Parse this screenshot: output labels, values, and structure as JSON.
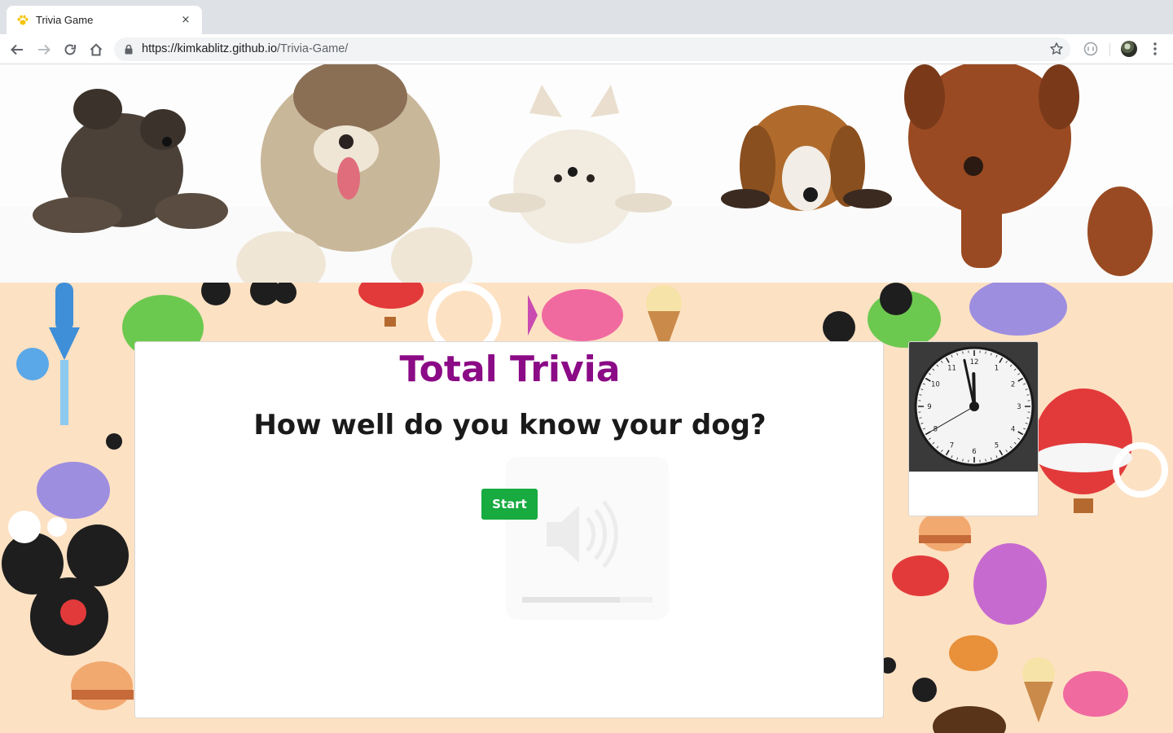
{
  "browser": {
    "tab_title": "Trivia Game",
    "tab_close": "×",
    "url_host": "https://kimkablitz.github.io",
    "url_path": "/Trivia-Game/"
  },
  "colors": {
    "title": "#8b0a86",
    "start_button": "#17ab40",
    "page_background": "#fde1c3"
  },
  "game": {
    "title": "Total Trivia",
    "subtitle": "How well do you know your dog?",
    "start_label": "Start"
  },
  "clock": {
    "numbers": [
      "12",
      "1",
      "2",
      "3",
      "4",
      "5",
      "6",
      "7",
      "8",
      "9",
      "10",
      "11"
    ],
    "time": {
      "hour": 11,
      "minute": 58,
      "second": 40
    }
  }
}
